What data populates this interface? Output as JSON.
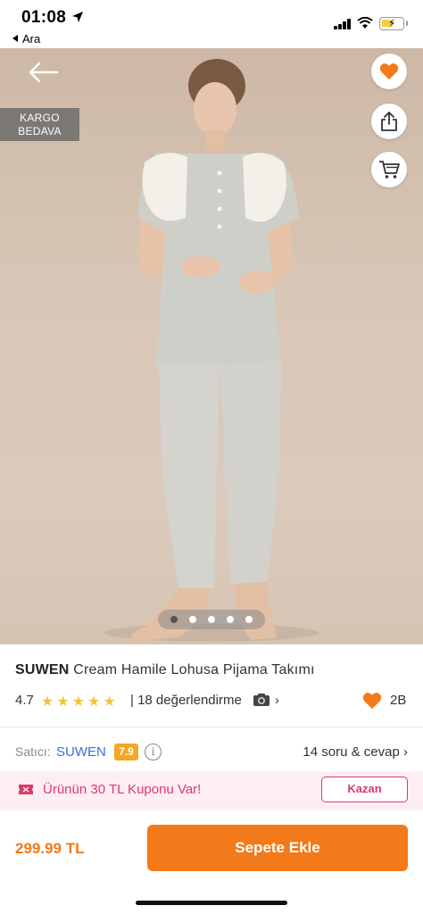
{
  "status_bar": {
    "time": "01:08",
    "back_app": "Ara"
  },
  "hero": {
    "badge_line1": "KARGO",
    "badge_line2": "BEDAVA",
    "icons": [
      "back-arrow-icon",
      "heart-icon",
      "share-icon",
      "cart-icon"
    ],
    "carousel": {
      "count": 5,
      "active": 0
    }
  },
  "product": {
    "brand": "SUWEN",
    "name": "Cream Hamile Lohusa Pijama Takımı",
    "rating": "4.7",
    "stars": 5,
    "reviews": "| 18 değerlendirme",
    "favorites": "2B"
  },
  "seller": {
    "label": "Satıcı:",
    "name": "SUWEN",
    "score": "7.9",
    "qa": "14 soru & cevap"
  },
  "coupon": {
    "text": "Ürünün 30 TL Kuponu Var!",
    "button": "Kazan"
  },
  "footer": {
    "price": "299.99 TL",
    "button": "Sepete Ekle"
  },
  "colors": {
    "accent": "#f27a1a",
    "coupon": "#e0386a",
    "seller_link": "#3a6fd8",
    "score_badge": "#f5a623"
  }
}
